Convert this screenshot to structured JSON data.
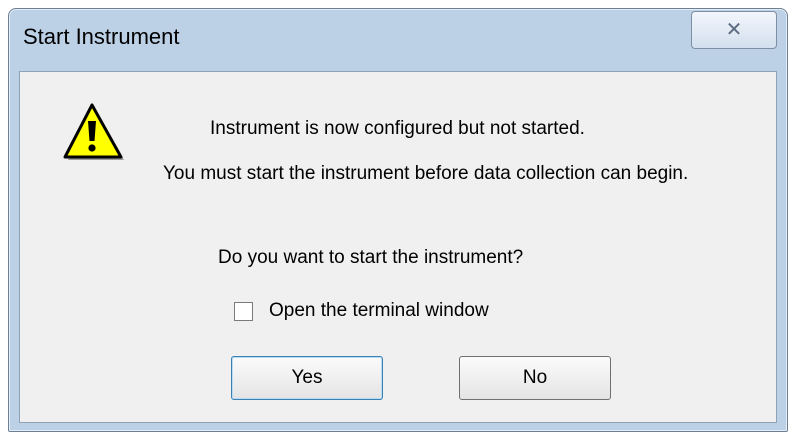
{
  "dialog": {
    "title": "Start Instrument",
    "close_glyph": "✕",
    "icon": "warning-icon",
    "message_line1": "Instrument is now configured but not started.",
    "message_line2": "You must start the instrument before data collection can begin.",
    "question": "Do you want to start the instrument?",
    "checkbox": {
      "label": "Open the terminal window",
      "checked": false
    },
    "buttons": {
      "yes": "Yes",
      "no": "No"
    }
  },
  "colors": {
    "frame": "#bcd0e6",
    "client": "#f0f0f0",
    "warning_fill": "#ffff00",
    "default_button_border": "#3c7fb1"
  }
}
